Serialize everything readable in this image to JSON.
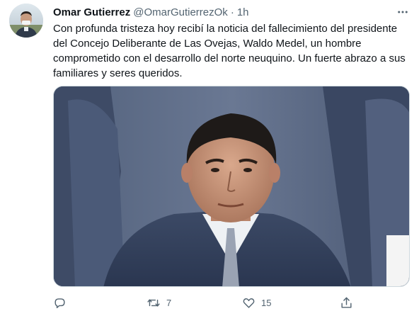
{
  "tweet": {
    "author": {
      "name": "Omar Gutierrez",
      "handle": "@OmarGutierrezOk",
      "avatar_icon": "user-avatar-photo"
    },
    "separator": "·",
    "time": "1h",
    "text": "Con profunda tristeza hoy recibí la noticia del fallecimiento del presidente del Concejo Deliberante de Las Ovejas, Waldo Medel, un hombre comprometido con el desarrollo del norte neuquino. Un fuerte abrazo a sus familiares y seres queridos.",
    "media": {
      "icon": "photo-of-man-in-suit"
    },
    "actions": {
      "reply": {
        "icon": "reply-icon",
        "count": ""
      },
      "retweet": {
        "icon": "retweet-icon",
        "count": "7"
      },
      "like": {
        "icon": "heart-icon",
        "count": "15"
      },
      "share": {
        "icon": "share-icon",
        "count": ""
      }
    }
  },
  "colors": {
    "text": "#0f1419",
    "secondary": "#536471",
    "border": "#cfd9de"
  }
}
